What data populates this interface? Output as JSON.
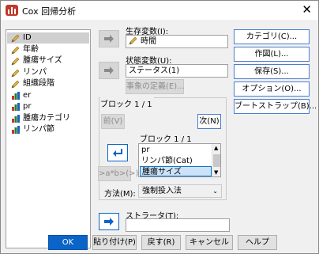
{
  "window": {
    "title": "Cox 回帰分析"
  },
  "variables": [
    {
      "label": "ID",
      "icon": "scale-pencil-icon",
      "selected": true
    },
    {
      "label": "年齢",
      "icon": "scale-pencil-icon"
    },
    {
      "label": "腫瘍サイズ",
      "icon": "scale-pencil-icon"
    },
    {
      "label": "リンパ",
      "icon": "scale-pencil-icon"
    },
    {
      "label": "組織段階",
      "icon": "scale-pencil-icon"
    },
    {
      "label": "er",
      "icon": "nominal-bar-icon"
    },
    {
      "label": "pr",
      "icon": "nominal-bar-icon"
    },
    {
      "label": "腫瘍カテゴリ",
      "icon": "nominal-bar-icon"
    },
    {
      "label": "リンパ節",
      "icon": "nominal-bar-icon"
    }
  ],
  "survival": {
    "label": "生存変数(I):",
    "value": "時間"
  },
  "status": {
    "label": "状態変数(U):",
    "value": "ステータス(1)",
    "define_event": "事象の定義(E)..."
  },
  "block": {
    "title": "ブロック 1 / 1",
    "prev": "前(V)",
    "next": "次(N)",
    "inner_title": "ブロック 1 / 1",
    "items": [
      "pr",
      "リンパ節(Cat)",
      "腫瘍サイズ"
    ],
    "interaction": ">a*b>(>)",
    "method_label": "方法(M):",
    "method_value": "強制投入法"
  },
  "strata": {
    "label": "ストラータ(T):",
    "value": ""
  },
  "right_buttons": [
    "カテゴリ(C)...",
    "作図(L)...",
    "保存(S)...",
    "オプション(O)...",
    "ブートストラップ(B)..."
  ],
  "bottom_buttons": [
    "OK",
    "貼り付け(P)",
    "戻す(R)",
    "キャンセル",
    "ヘルプ"
  ],
  "colors": {
    "accent": "#0b64c8",
    "selection": "#cfcfcf"
  }
}
